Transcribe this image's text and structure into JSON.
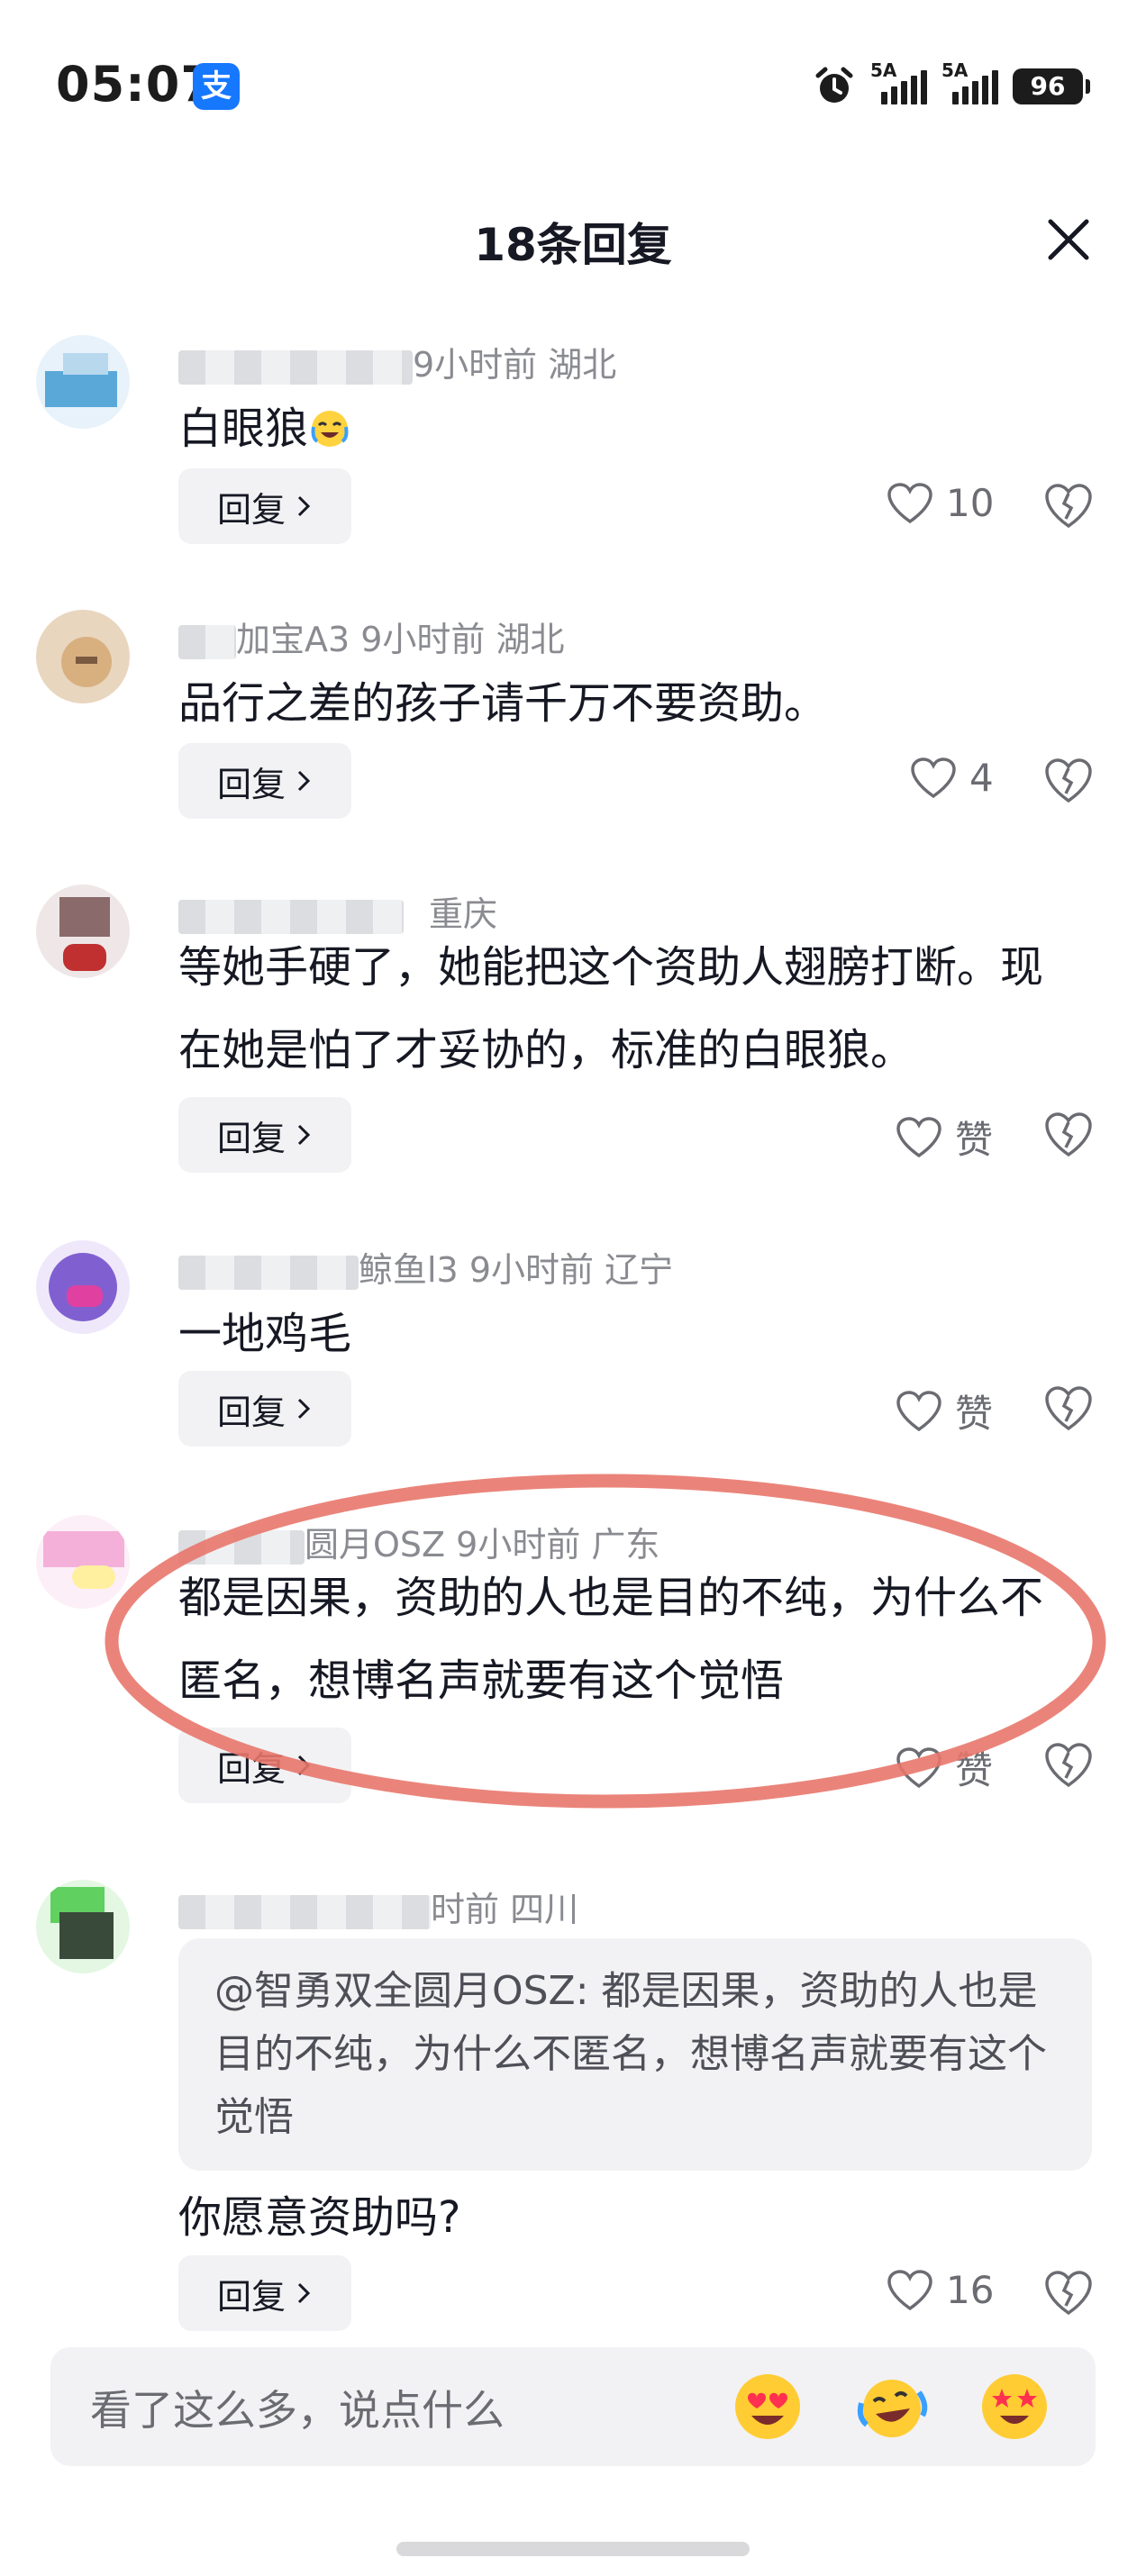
{
  "status_bar": {
    "time": "05:07",
    "alipay_glyph": "支",
    "network_1": "5A",
    "network_2": "5A",
    "battery": "96"
  },
  "header": {
    "title": "18条回复"
  },
  "comments": [
    {
      "meta": "9小时前  湖北",
      "text": "白眼狼",
      "reply": "回复",
      "likes": "10",
      "avatar_colors": [
        "#5aa8d8",
        "#e8f2fa"
      ]
    },
    {
      "meta": "加宝A3  9小时前  湖北",
      "text": "品行之差的孩子请千万不要资助。",
      "reply": "回复",
      "likes": "4",
      "avatar_colors": [
        "#d8b080",
        "#a88060"
      ]
    },
    {
      "meta": "重庆",
      "text": "等她手硬了，她能把这个资助人翅膀打断。现在她是怕了才妥协的，标准的白眼狼。",
      "reply": "回复",
      "likes": "赞",
      "avatar_colors": [
        "#8a6a6a",
        "#c03030"
      ]
    },
    {
      "meta": "鲸鱼l3  9小时前  辽宁",
      "text": "一地鸡毛",
      "reply": "回复",
      "likes": "赞",
      "avatar_colors": [
        "#8060d0",
        "#e040a0"
      ]
    },
    {
      "meta": "圆月OSZ  9小时前  广东",
      "text": "都是因果，资助的人也是目的不纯，为什么不匿名，想博名声就要有这个觉悟",
      "reply": "回复",
      "likes": "赞",
      "avatar_colors": [
        "#f4b0d8",
        "#fff0a0"
      ]
    },
    {
      "meta": "时前  四川",
      "quote": "@智勇双全圆月OSZ: 都是因果，资助的人也是目的不纯，为什么不匿名，想博名声就要有这个觉悟",
      "text": "你愿意资助吗?",
      "reply": "回复",
      "likes": "16",
      "avatar_colors": [
        "#3a4a3a",
        "#60d060"
      ]
    }
  ],
  "input": {
    "placeholder": "看了这么多，说点什么"
  },
  "icons": [
    "alarm-icon",
    "close-icon",
    "heart-icon",
    "broken-heart-icon",
    "chevron-right-icon",
    "heart-eyes-emoji",
    "laughing-crying-emoji",
    "star-struck-emoji"
  ],
  "colors": {
    "highlight": "#e8776c",
    "secondary_text": "#8a8b91",
    "input_bg": "#f2f2f4"
  }
}
